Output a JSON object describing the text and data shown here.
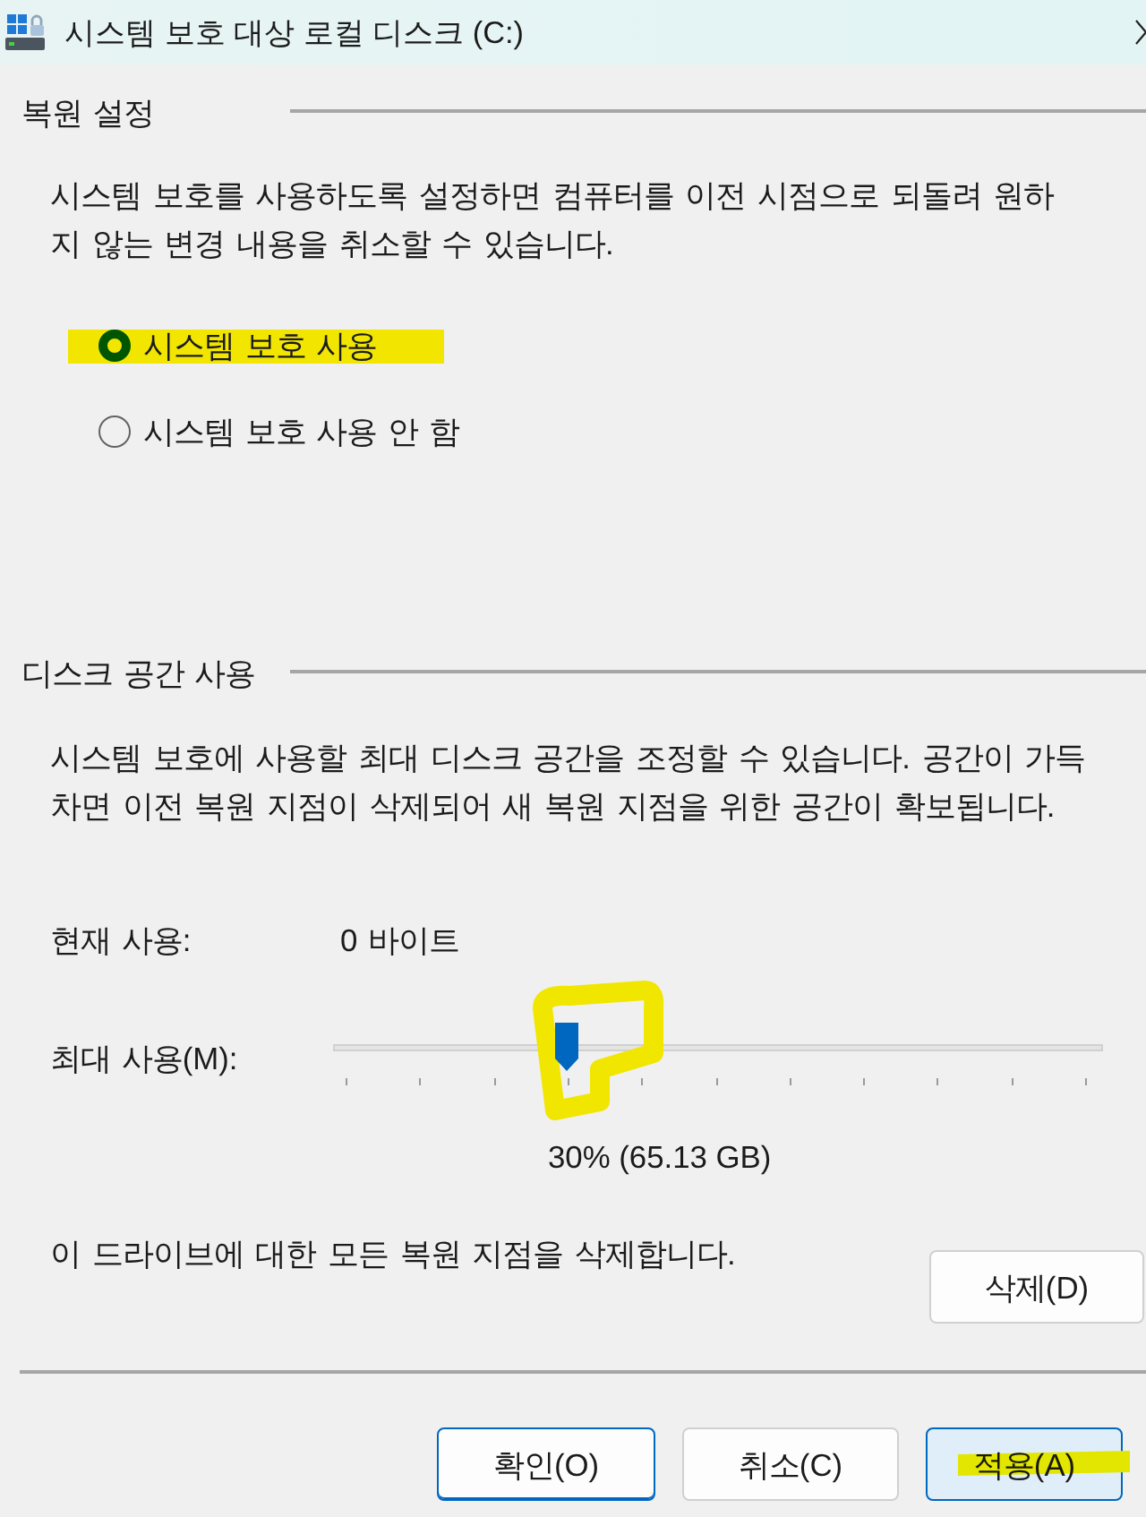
{
  "window": {
    "title": "시스템 보호 대상 로컬 디스크 (C:)"
  },
  "restore_settings": {
    "heading": "복원 설정",
    "description": "시스템 보호를 사용하도록 설정하면 컴퓨터를 이전 시점으로 되돌려 원하지 않는 변경 내용을 취소할 수 있습니다.",
    "options": [
      {
        "label": "시스템 보호 사용",
        "selected": true,
        "highlighted": true
      },
      {
        "label": "시스템 보호 사용 안 함",
        "selected": false,
        "highlighted": false
      }
    ]
  },
  "disk_space": {
    "heading": "디스크 공간 사용",
    "description": "시스템 보호에 사용할 최대 디스크 공간을 조정할 수 있습니다. 공간이 가득 차면 이전 복원 지점이 삭제되어 새 복원 지점을 위한 공간이 확보됩니다.",
    "current_usage": {
      "label": "현재 사용:",
      "value": "0 바이트"
    },
    "max_usage": {
      "label": "최대 사용(M):",
      "level": 0.3,
      "highlighted": true,
      "reading": "30% (65.13 GB)"
    }
  },
  "delete_row": {
    "text": "이 드라이브에 대한 모든 복원 지점을 삭제합니다.",
    "button": "삭제(D)"
  },
  "buttons": [
    {
      "label": "확인(O)",
      "default": true,
      "hovered": false,
      "highlighted": false
    },
    {
      "label": "취소(C)",
      "default": false,
      "hovered": false,
      "highlighted": false
    },
    {
      "label": "적용(A)",
      "default": false,
      "hovered": true,
      "highlighted": true
    }
  ]
}
